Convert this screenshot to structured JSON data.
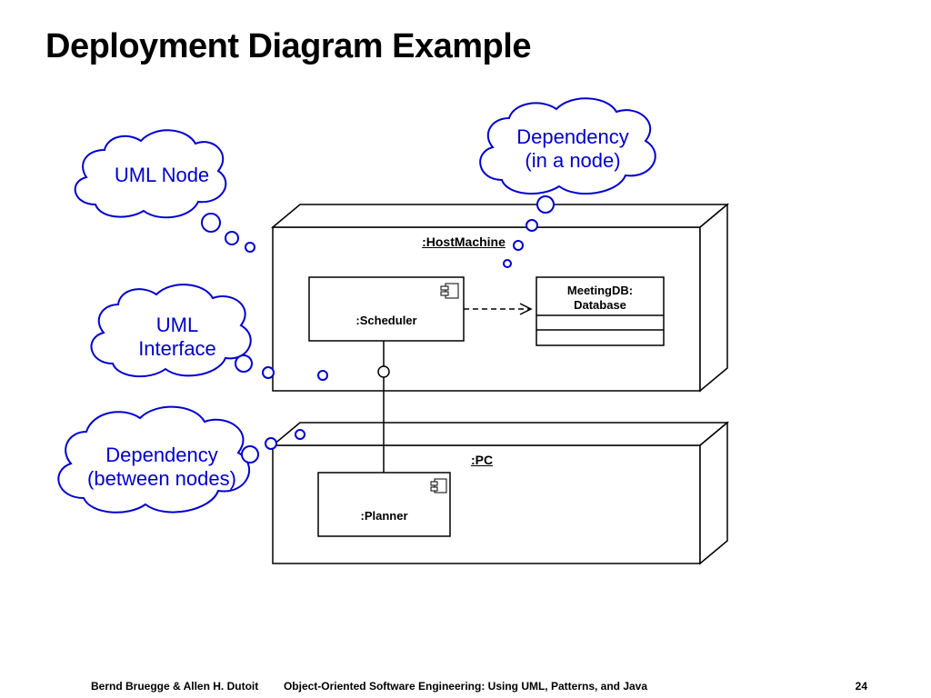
{
  "title": "Deployment Diagram Example",
  "clouds": {
    "uml_node": "UML Node",
    "dep_in_node_l1": "Dependency",
    "dep_in_node_l2": "(in a node)",
    "uml_interface_l1": "UML",
    "uml_interface_l2": "Interface",
    "dep_between_l1": "Dependency",
    "dep_between_l2": "(between nodes)"
  },
  "nodes": {
    "host": ":HostMachine",
    "pc": ":PC"
  },
  "components": {
    "scheduler": ":Scheduler",
    "planner": ":Planner",
    "meetingdb_l1": "MeetingDB:",
    "meetingdb_l2": "Database"
  },
  "footer": {
    "left": "Bernd Bruegge & Allen H. Dutoit",
    "center": "Object-Oriented Software Engineering: Using UML, Patterns, and Java",
    "right": "24"
  }
}
